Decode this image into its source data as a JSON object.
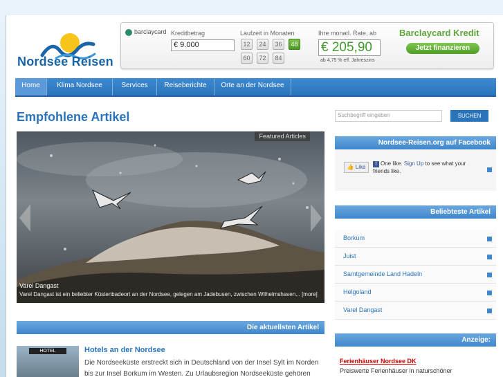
{
  "brand": {
    "logo_text": "Nordsee Reisen",
    "color": "#1a64a8"
  },
  "banner": {
    "provider": "barclaycard",
    "kredit_label": "Kreditbetrag",
    "kredit_value": "€ 9.000",
    "laufzeit_label": "Laufzeit in Monaten",
    "terms": [
      "12",
      "24",
      "36",
      "48",
      "60",
      "72",
      "84"
    ],
    "selected_term": "48",
    "rate_label": "Ihre monatl. Rate, ab",
    "rate_value": "€ 205,90",
    "eff_text": "ab 4,75 % eff. Jahreszins",
    "title": "Barclaycard Kredit",
    "button": "Jetzt finanzieren"
  },
  "nav": [
    "Home",
    "Klima Nordsee",
    "Services",
    "Reiseberichte",
    "Orte an der Nordsee"
  ],
  "main": {
    "heading": "Empfohlene Artikel",
    "featured": {
      "tag": "Featured Articles",
      "title": "Varel Dangast",
      "text": "Varel Dangast ist ein beliebter Küstenbadeort an der Nordsee, gelegen am Jadebusen, zwischen Wilhelmshaven... [more]"
    },
    "latest_header": "Die aktuellsten Artikel",
    "article": {
      "sign": "HOTEL",
      "title": "Hotels an der Nordsee",
      "text": "Die Nordseeküste erstreckt sich in Deutschland von der Insel Sylt im Norden bis zur Insel Borkum im Westen. Zu Urlaubsregion Nordseeküste gehören neben"
    }
  },
  "sidebar": {
    "search_placeholder": "Suchbegriff eingeben",
    "search_button": "SUCHEN",
    "facebook_header": "Nordsee-Reisen.org auf Facebook",
    "like_label": "Like",
    "fb_text_pre": "One like.",
    "fb_signup": "Sign Up",
    "fb_text_post": "to see what your friends like.",
    "popular_header": "Beliebteste Artikel",
    "popular": [
      "Borkum",
      "Juist",
      "Samtgemeinde Land Hadeln",
      "Helgoland",
      "Varel Dangast"
    ],
    "ad_header": "Anzeige:",
    "ad_title": "Ferienhäuser Nordsee DK",
    "ad_text": "Preiswerte Ferienhäuser in naturschöner"
  }
}
